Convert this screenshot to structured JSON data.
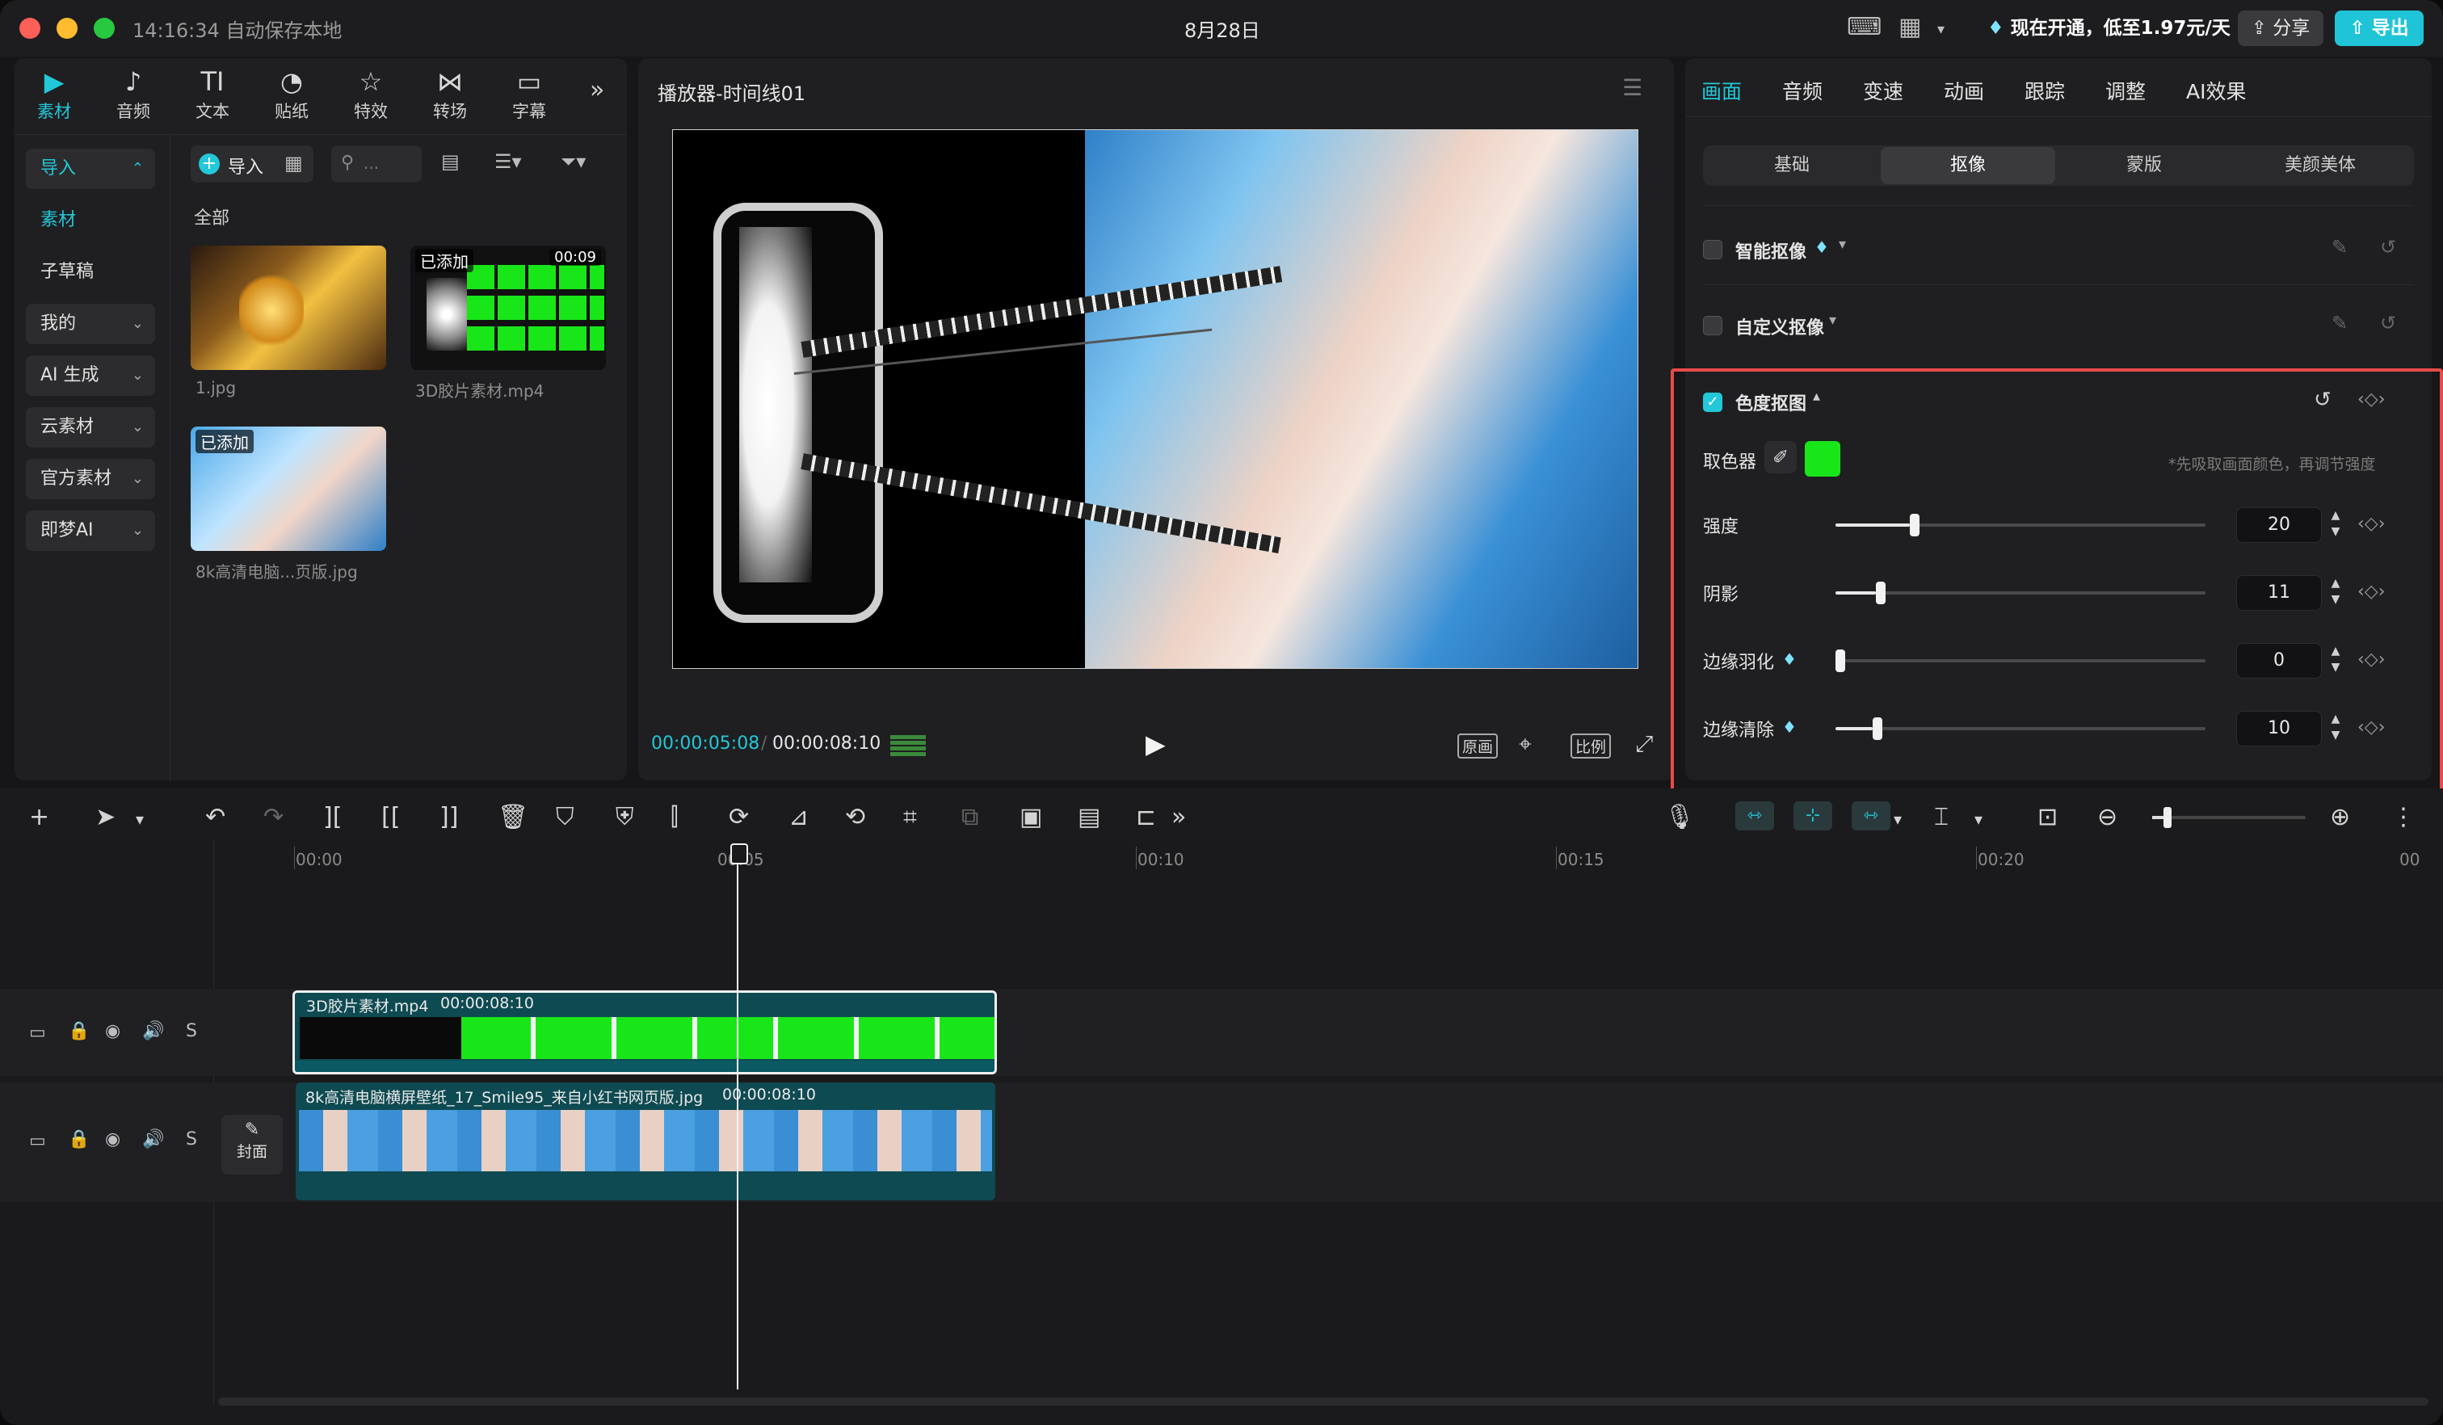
{
  "titlebar": {
    "time_status": "14:16:34 自动保存本地",
    "date": "8月28日",
    "promo_text": "现在开通，低至1.97元/天",
    "share_label": "分享",
    "export_label": "导出"
  },
  "tool_tabs": [
    {
      "label": "素材",
      "icon": "media-icon"
    },
    {
      "label": "音频",
      "icon": "audio-icon"
    },
    {
      "label": "文本",
      "icon": "text-icon"
    },
    {
      "label": "贴纸",
      "icon": "sticker-icon"
    },
    {
      "label": "特效",
      "icon": "effects-icon"
    },
    {
      "label": "转场",
      "icon": "transition-icon"
    },
    {
      "label": "字幕",
      "icon": "subtitle-icon"
    }
  ],
  "left_nav": [
    {
      "label": "导入"
    },
    {
      "label": "素材"
    },
    {
      "label": "子草稿"
    },
    {
      "label": "我的"
    },
    {
      "label": "AI 生成"
    },
    {
      "label": "云素材"
    },
    {
      "label": "官方素材"
    },
    {
      "label": "即梦AI"
    }
  ],
  "media": {
    "import_label": "导入",
    "search_placeholder": "...",
    "section_label": "全部",
    "items": [
      {
        "name": "1.jpg",
        "badge": "",
        "duration": ""
      },
      {
        "name": "3D胶片素材.mp4",
        "badge": "已添加",
        "duration": "00:09"
      },
      {
        "name": "8k高清电脑...页版.jpg",
        "badge": "已添加",
        "duration": ""
      }
    ]
  },
  "player": {
    "title": "播放器-时间线01",
    "current_time": "00:00:05:08",
    "total_time": "00:00:08:10",
    "btn_original": "原画",
    "btn_ratio": "比例"
  },
  "inspector": {
    "tabs": [
      "画面",
      "音频",
      "变速",
      "动画",
      "跟踪",
      "调整",
      "AI效果"
    ],
    "subtabs": [
      "基础",
      "抠像",
      "蒙版",
      "美颜美体"
    ],
    "smart_cutout": "智能抠像",
    "custom_cutout": "自定义抠像",
    "chroma_key": "色度抠图",
    "picker_label": "取色器",
    "picker_hint": "*先吸取画面颜色，再调节强度",
    "picker_color": "#19e619",
    "accent_color": "#22c8d8",
    "highlight_color": "#e84a4a",
    "sliders": [
      {
        "label": "强度",
        "value": "20",
        "fraction": 0.2
      },
      {
        "label": "阴影",
        "value": "11",
        "fraction": 0.11
      },
      {
        "label": "边缘羽化",
        "value": "0",
        "fraction": 0.0
      },
      {
        "label": "边缘清除",
        "value": "10",
        "fraction": 0.1
      }
    ]
  },
  "timeline": {
    "ruler": [
      "00:00",
      "00:05",
      "00:10",
      "00:15",
      "00:20",
      "00"
    ],
    "cover_label": "封面",
    "clips": [
      {
        "title": "3D胶片素材.mp4",
        "duration": "00:00:08:10"
      },
      {
        "title": "8k高清电脑横屏壁纸_17_Smile95_来自小红书网页版.jpg",
        "duration": "00:00:08:10"
      }
    ],
    "track_s": "S"
  }
}
